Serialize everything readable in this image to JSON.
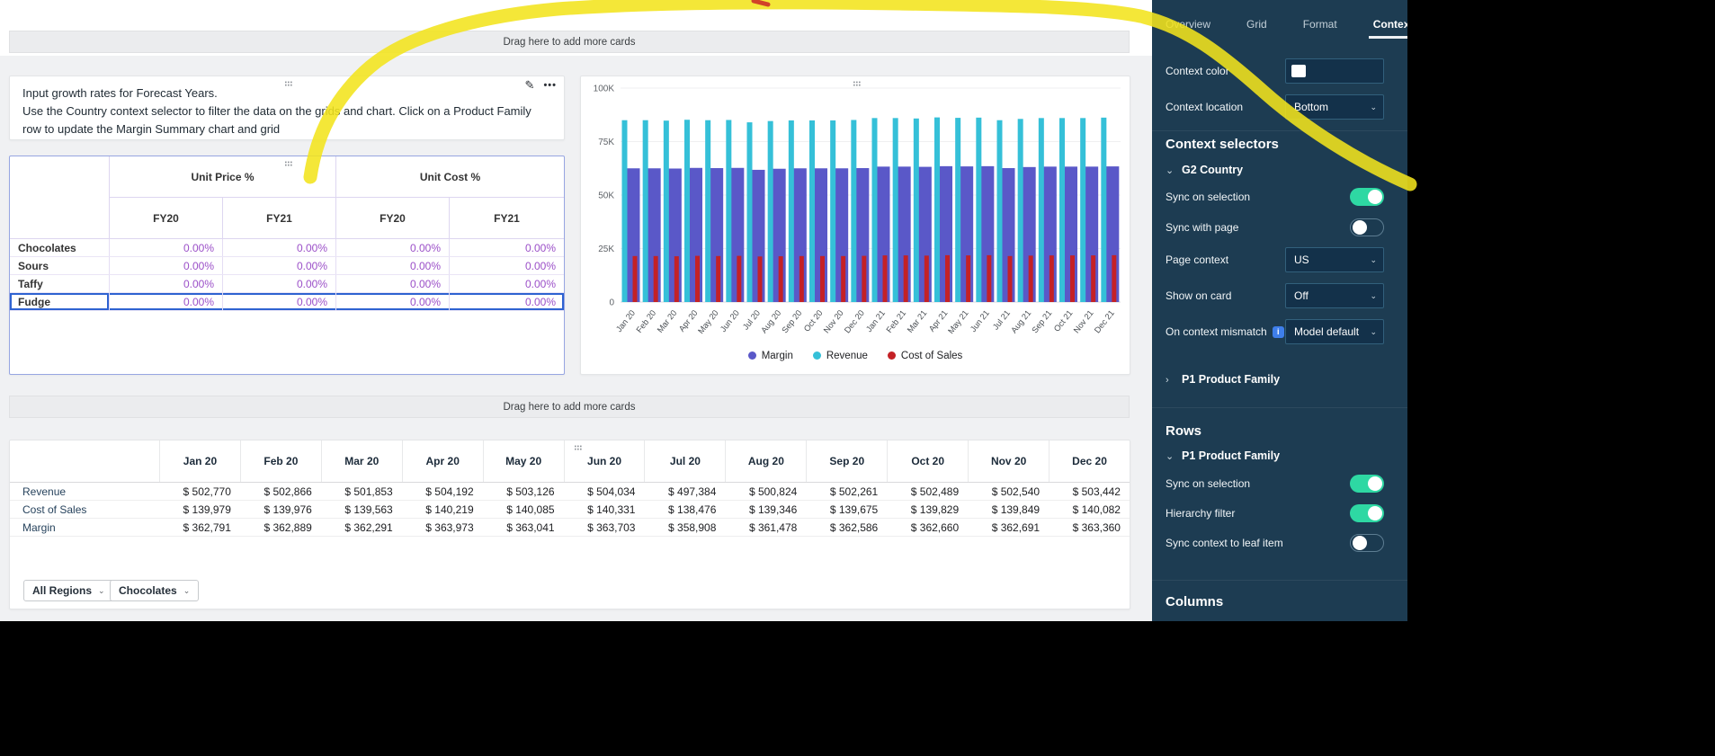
{
  "drop_zone_label": "Drag here to add more cards",
  "text_card": {
    "line1": "Input growth rates for Forecast Years.",
    "line2": "Use the Country context selector to filter the data on the grids and chart. Click on a Product Family row to update the Margin Summary chart and grid"
  },
  "input_grid": {
    "col_groups": [
      "Unit Price %",
      "Unit Cost %"
    ],
    "sub_cols": [
      "FY20",
      "FY21",
      "FY20",
      "FY21"
    ],
    "rows": [
      {
        "label": "Chocolates",
        "values": [
          "0.00%",
          "0.00%",
          "0.00%",
          "0.00%"
        ]
      },
      {
        "label": "Sours",
        "values": [
          "0.00%",
          "0.00%",
          "0.00%",
          "0.00%"
        ]
      },
      {
        "label": "Taffy",
        "values": [
          "0.00%",
          "0.00%",
          "0.00%",
          "0.00%"
        ]
      },
      {
        "label": "Fudge",
        "values": [
          "0.00%",
          "0.00%",
          "0.00%",
          "0.00%"
        ]
      }
    ],
    "selected_row": "Fudge"
  },
  "chart_data": {
    "type": "bar",
    "categories": [
      "Jan 20",
      "Feb 20",
      "Mar 20",
      "Apr 20",
      "May 20",
      "Jun 20",
      "Jul 20",
      "Aug 20",
      "Sep 20",
      "Oct 20",
      "Nov 20",
      "Dec 20",
      "Jan 21",
      "Feb 21",
      "Mar 21",
      "Apr 21",
      "May 21",
      "Jun 21",
      "Jul 21",
      "Aug 21",
      "Sep 21",
      "Oct 21",
      "Nov 21",
      "Dec 21"
    ],
    "series": [
      {
        "name": "Margin",
        "color": "#5a58c8",
        "values": [
          62.5,
          62.5,
          62.4,
          62.7,
          62.6,
          62.7,
          61.8,
          62.3,
          62.5,
          62.5,
          62.5,
          62.6,
          63.3,
          63.3,
          63.2,
          63.5,
          63.4,
          63.5,
          62.6,
          63.1,
          63.3,
          63.3,
          63.3,
          63.4
        ]
      },
      {
        "name": "Revenue",
        "color": "#35c0d8",
        "values": [
          85.0,
          85.0,
          84.8,
          85.2,
          85.0,
          85.1,
          84.0,
          84.6,
          84.9,
          84.9,
          84.9,
          85.1,
          86.0,
          86.0,
          85.8,
          86.3,
          86.1,
          86.2,
          85.0,
          85.6,
          86.0,
          86.0,
          86.0,
          86.2
        ]
      },
      {
        "name": "Cost of Sales",
        "color": "#c42126",
        "values": [
          21.5,
          21.5,
          21.4,
          21.6,
          21.5,
          21.6,
          21.3,
          21.4,
          21.5,
          21.5,
          21.5,
          21.6,
          21.8,
          21.8,
          21.7,
          21.9,
          21.8,
          21.9,
          21.5,
          21.7,
          21.8,
          21.8,
          21.8,
          21.9
        ]
      }
    ],
    "unit": "K",
    "y_ticks": [
      "0",
      "25K",
      "50K",
      "75K",
      "100K"
    ],
    "ylim": [
      0,
      100
    ],
    "grid": true,
    "legend_position": "bottom"
  },
  "bottom_table": {
    "columns": [
      "Jan 20",
      "Feb 20",
      "Mar 20",
      "Apr 20",
      "May 20",
      "Jun 20",
      "Jul 20",
      "Aug 20",
      "Sep 20",
      "Oct 20",
      "Nov 20",
      "Dec 20"
    ],
    "rows": [
      {
        "label": "Revenue",
        "values": [
          "$ 502,770",
          "$ 502,866",
          "$ 501,853",
          "$ 504,192",
          "$ 503,126",
          "$ 504,034",
          "$ 497,384",
          "$ 500,824",
          "$ 502,261",
          "$ 502,489",
          "$ 502,540",
          "$ 503,442"
        ]
      },
      {
        "label": "Cost of Sales",
        "values": [
          "$ 139,979",
          "$ 139,976",
          "$ 139,563",
          "$ 140,219",
          "$ 140,085",
          "$ 140,331",
          "$ 138,476",
          "$ 139,346",
          "$ 139,675",
          "$ 139,829",
          "$ 139,849",
          "$ 140,082"
        ]
      },
      {
        "label": "Margin",
        "values": [
          "$ 362,791",
          "$ 362,889",
          "$ 362,291",
          "$ 363,973",
          "$ 363,041",
          "$ 363,703",
          "$ 358,908",
          "$ 361,478",
          "$ 362,586",
          "$ 362,660",
          "$ 362,691",
          "$ 363,360"
        ]
      }
    ]
  },
  "page_selectors": [
    {
      "label": "All Regions"
    },
    {
      "label": "Chocolates"
    }
  ],
  "panel": {
    "tabs": [
      "Overview",
      "Grid",
      "Format",
      "Context"
    ],
    "active_tab": "Context",
    "context_color_label": "Context color",
    "context_location_label": "Context location",
    "context_location_value": "Bottom",
    "selectors_heading": "Context selectors",
    "g2_country": {
      "label": "G2 Country",
      "sync_on_selection": {
        "label": "Sync on selection",
        "on": true
      },
      "sync_with_page": {
        "label": "Sync with page",
        "on": false
      },
      "page_context": {
        "label": "Page context",
        "value": "US"
      },
      "show_on_card": {
        "label": "Show on card",
        "value": "Off"
      },
      "on_context_mismatch": {
        "label": "On context mismatch",
        "value": "Model default"
      }
    },
    "p1_selector_label": "P1 Product Family",
    "rows_heading": "Rows",
    "rows_group": {
      "label": "P1 Product Family",
      "sync_on_selection": {
        "label": "Sync on selection",
        "on": true
      },
      "hierarchy_filter": {
        "label": "Hierarchy filter",
        "on": true
      },
      "sync_context_to_leaf": {
        "label": "Sync context to leaf item",
        "on": false
      }
    },
    "columns_heading": "Columns"
  },
  "annotation": {
    "color": "#f2e41c",
    "secondary_color": "#cf3a28"
  }
}
